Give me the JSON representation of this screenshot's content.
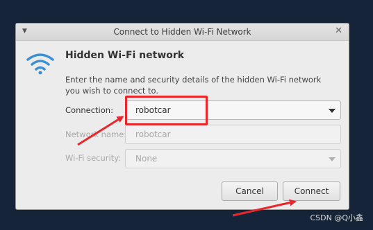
{
  "dialog": {
    "title": "Connect to Hidden Wi-Fi Network",
    "heading": "Hidden Wi-Fi network",
    "description": "Enter the name and security details of the hidden Wi-Fi network you wish to connect to."
  },
  "form": {
    "connection": {
      "label": "Connection:",
      "value": "robotcar"
    },
    "network_name": {
      "label": "Network name:",
      "value": "robotcar"
    },
    "wifi_security": {
      "label": "Wi-Fi security:",
      "value": "None"
    }
  },
  "buttons": {
    "cancel": "Cancel",
    "connect": "Connect"
  },
  "colors": {
    "annotation": "#e8262b",
    "wifi_icon": "#3b8fd9",
    "background": "#152438"
  },
  "watermark": "CSDN @Q小鑫"
}
